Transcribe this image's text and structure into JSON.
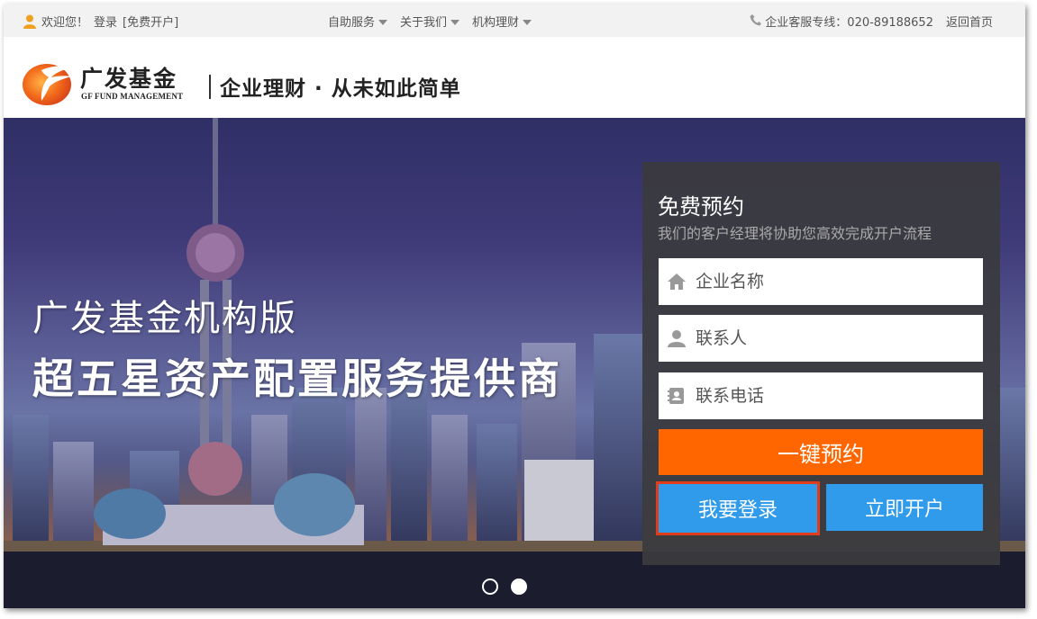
{
  "topbar": {
    "welcome": "欢迎您！",
    "login_link": "登录",
    "register_link": "[免费开户]",
    "menus": [
      "自助服务",
      "关于我们",
      "机构理财"
    ],
    "hotline": "企业客服专线：020-89188652",
    "home_link": "返回首页"
  },
  "header": {
    "logo_cn": "广发基金",
    "logo_en": "GF FUND MANAGEMENT",
    "slogan": "企业理财 · 从未如此简单"
  },
  "banner": {
    "headline1": "广发基金机构版",
    "headline2": "超五星资产配置服务提供商",
    "slides_total": 2,
    "active_slide": 2
  },
  "form": {
    "title": "免费预约",
    "subtitle": "我们的客户经理将协助您高效完成开户流程",
    "company_placeholder": "企业名称",
    "contact_placeholder": "联系人",
    "phone_placeholder": "联系电话",
    "submit_label": "一键预约",
    "login_label": "我要登录",
    "open_label": "立即开户"
  },
  "colors": {
    "accent_orange": "#ff6600",
    "button_blue": "#2f9bea",
    "highlight_red": "#e03e1a",
    "panel_bg": "#3a3a3e"
  },
  "icons": [
    "user-icon",
    "caret-down-icon",
    "phone-icon",
    "gf-logo-icon",
    "home-icon",
    "person-icon",
    "contact-card-icon"
  ]
}
